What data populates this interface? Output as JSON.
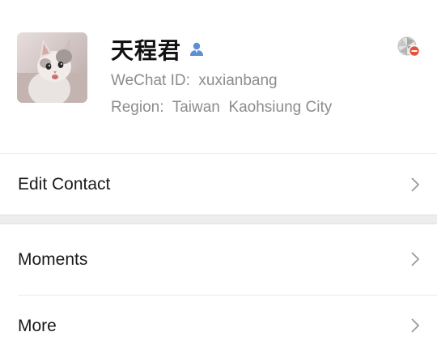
{
  "profile": {
    "name": "天程君",
    "wechat_id_label": "WeChat ID:",
    "wechat_id": "xuxianbang",
    "region_label": "Region:",
    "region_country": "Taiwan",
    "region_city": "Kaohsiung City",
    "gender_icon": "person-icon",
    "status_icon": "aperture-blocked-icon"
  },
  "rows": {
    "edit_contact": "Edit Contact",
    "moments": "Moments",
    "more": "More"
  },
  "colors": {
    "accent_blue": "#5b8fd6",
    "badge_red": "#e5533d",
    "text_primary": "#1a1a1a",
    "text_secondary": "#8c8c8c",
    "section_gap": "#ededed"
  }
}
